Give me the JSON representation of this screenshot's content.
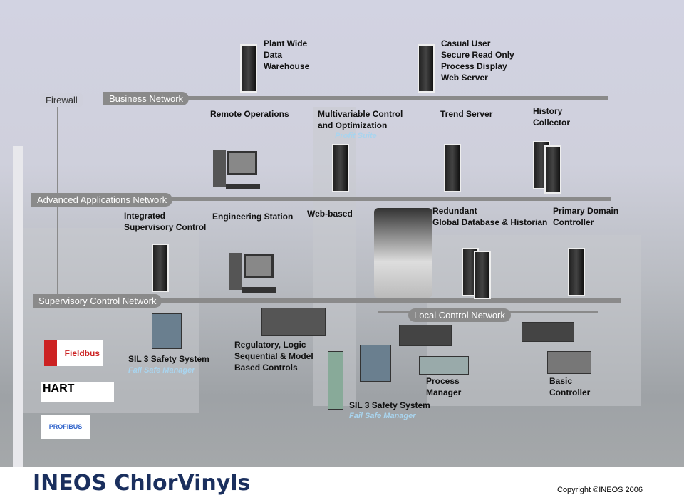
{
  "networks": {
    "firewall": "Firewall",
    "business": "Business Network",
    "advanced": "Advanced Applications Network",
    "supervisory": "Supervisory Control Network",
    "local": "Local Control Network"
  },
  "nodes": {
    "warehouse": "Plant Wide\nData\nWarehouse",
    "webserver": "Casual User\nSecure Read Only\nProcess Display\nWeb Server",
    "remote": "Remote Operations",
    "mvc": "Multivariable Control\nand Optimization",
    "mvc_sub": "Profit Suite",
    "trend": "Trend Server",
    "history": "History\nCollector",
    "isc": "Integrated\nSupervisory Control",
    "eng": "Engineering Station",
    "web": "Web-based",
    "redundant": "Redundant\nGlobal Database & Historian",
    "pdc": "Primary Domain\nController",
    "sil1": "SIL 3 Safety System",
    "sil1_sub": "Fail Safe Manager",
    "reg": "Regulatory, Logic\nSequential & Model\nBased Controls",
    "sil2": "SIL 3 Safety System",
    "sil2_sub": "Fail Safe Manager",
    "pm": "Process\nManager",
    "basic": "Basic\nController"
  },
  "logos": {
    "fieldbus": "Fieldbus",
    "hart": "HART",
    "profibus": "PROFIBUS"
  },
  "footer": {
    "brand": "INEOS ChlorVinyls",
    "copyright": "Copyright ©INEOS 2006"
  }
}
